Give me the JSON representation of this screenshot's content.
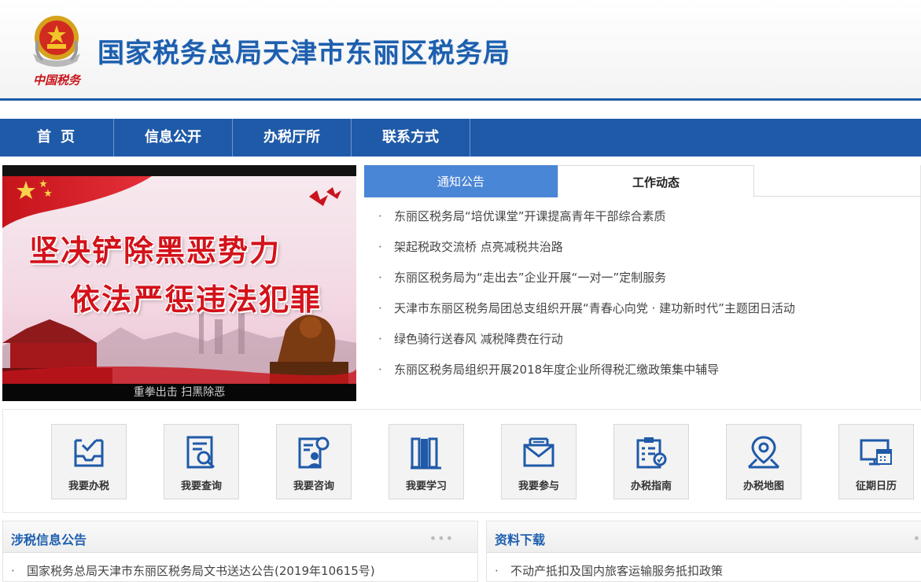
{
  "header": {
    "site_title": "国家税务总局天津市东丽区税务局",
    "logo_text": "中国税务"
  },
  "nav": {
    "items": [
      "首页",
      "信息公开",
      "办税厅所",
      "联系方式"
    ]
  },
  "banner": {
    "line1": "坚决铲除黑恶势力",
    "line2": "依法严惩违法犯罪",
    "caption": "重拳出击 扫黑除恶"
  },
  "tabs": {
    "tab1": "通知公告",
    "tab2": "工作动态",
    "active": "工作动态",
    "items": [
      "东丽区税务局“培优课堂”开课提高青年干部综合素质",
      "架起税政交流桥 点亮减税共治路",
      "东丽区税务局为“走出去”企业开展“一对一”定制服务",
      "天津市东丽区税务局团总支组织开展“青春心向党 · 建功新时代”主题团日活动",
      "绿色骑行送春风 减税降费在行动",
      "东丽区税务局组织开展2018年度企业所得税汇缴政策集中辅导"
    ]
  },
  "quick_links": [
    {
      "label": "我要办税",
      "icon": "tray-check-icon"
    },
    {
      "label": "我要查询",
      "icon": "document-search-icon"
    },
    {
      "label": "我要咨询",
      "icon": "consult-person-icon"
    },
    {
      "label": "我要学习",
      "icon": "books-icon"
    },
    {
      "label": "我要参与",
      "icon": "envelope-icon"
    },
    {
      "label": "办税指南",
      "icon": "clipboard-guide-icon"
    },
    {
      "label": "办税地图",
      "icon": "map-pin-icon"
    },
    {
      "label": "征期日历",
      "icon": "calendar-monitor-icon"
    }
  ],
  "sections": {
    "tax_notice": {
      "title": "涉税信息公告",
      "more": "•••",
      "item": "国家税务总局天津市东丽区税务局文书送达公告(2019年10615号)"
    },
    "downloads": {
      "title": "资料下载",
      "more": "•",
      "item": "不动产抵扣及国内旅客运输服务抵扣政策"
    }
  },
  "colors": {
    "brand_blue": "#1f5aa8",
    "tab_active_blue": "#4a86d6",
    "title_blue": "#1d5fae",
    "banner_red": "#d3121a"
  }
}
